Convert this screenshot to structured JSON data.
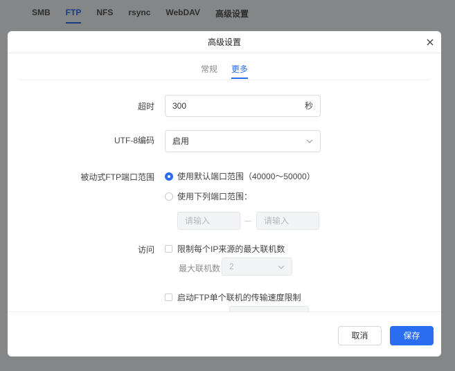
{
  "background_tabs": [
    {
      "label": "SMB",
      "active": false
    },
    {
      "label": "FTP",
      "active": true
    },
    {
      "label": "NFS",
      "active": false
    },
    {
      "label": "rsync",
      "active": false
    },
    {
      "label": "WebDAV",
      "active": false
    },
    {
      "label": "高级设置",
      "active": false
    }
  ],
  "dialog": {
    "title": "高级设置",
    "subtabs": [
      {
        "label": "常规",
        "active": false
      },
      {
        "label": "更多",
        "active": true
      }
    ],
    "timeout": {
      "label": "超时",
      "value": "300",
      "unit": "秒"
    },
    "utf8": {
      "label": "UTF-8编码",
      "value": "启用"
    },
    "passive_ports": {
      "label": "被动式FTP端口范围",
      "option_default": "使用默认端口范围（40000～50000）",
      "option_custom": "使用下列端口范围：",
      "selected": "default",
      "start_placeholder": "请输入",
      "end_placeholder": "请输入"
    },
    "access": {
      "label": "访问",
      "limit_connections": "限制每个IP来源的最大联机数",
      "max_connections_label": "最大联机数",
      "max_connections_value": "2",
      "speed_limit": "启动FTP单个联机的传输速度限制"
    },
    "footer": {
      "cancel": "取消",
      "save": "保存"
    }
  },
  "colors": {
    "accent": "#2b6df0"
  }
}
